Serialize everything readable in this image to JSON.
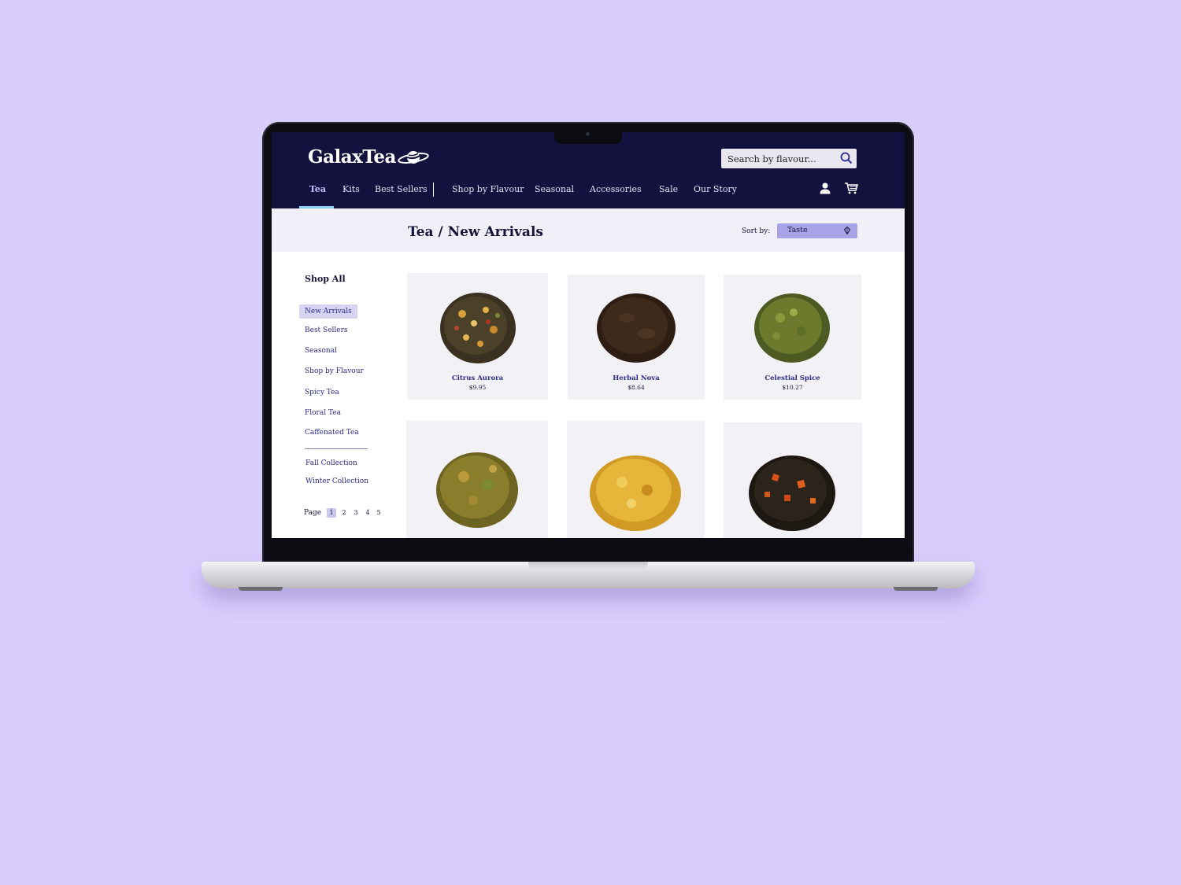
{
  "brand": {
    "name": "GalaxTea"
  },
  "search": {
    "placeholder": "Search by flavour..."
  },
  "nav": {
    "items": [
      {
        "label": "Tea",
        "active": true
      },
      {
        "label": "Kits"
      },
      {
        "label": "Best Sellers"
      },
      {
        "label": "Shop by Flavour"
      },
      {
        "label": "Seasonal"
      },
      {
        "label": "Accessories"
      },
      {
        "label": "Sale"
      },
      {
        "label": "Our Story"
      }
    ],
    "icons": [
      "user-icon",
      "cart-icon"
    ]
  },
  "page": {
    "title": "Tea / New Arrivals",
    "sort_label": "Sort by:",
    "sort_value": "Taste"
  },
  "sidebar": {
    "title": "Shop All",
    "items": [
      {
        "label": "New Arrivals",
        "active": true
      },
      {
        "label": "Best Sellers"
      },
      {
        "label": "Seasonal"
      },
      {
        "label": "Shop by Flavour"
      },
      {
        "label": "Spicy Tea"
      },
      {
        "label": "Floral Tea"
      },
      {
        "label": "Caffenated Tea"
      }
    ],
    "collections": [
      {
        "label": "Fall Collection"
      },
      {
        "label": "Winter Collection"
      }
    ]
  },
  "pagination": {
    "label": "Page",
    "pages": [
      "1",
      "2",
      "3",
      "4",
      "5"
    ],
    "current": "1"
  },
  "products": [
    {
      "name": "Citrus Aurora",
      "price": "$9.95"
    },
    {
      "name": "Herbal Nova",
      "price": "$8.64"
    },
    {
      "name": "Celestial Spice",
      "price": "$10.27"
    },
    {
      "name": "",
      "price": ""
    },
    {
      "name": "",
      "price": ""
    },
    {
      "name": "",
      "price": ""
    }
  ],
  "colors": {
    "background": "#d9cdfc",
    "header": "#13123f",
    "accent": "#a7a3e6",
    "link": "#2c2b8a",
    "active_underline": "#8fd0f0"
  }
}
